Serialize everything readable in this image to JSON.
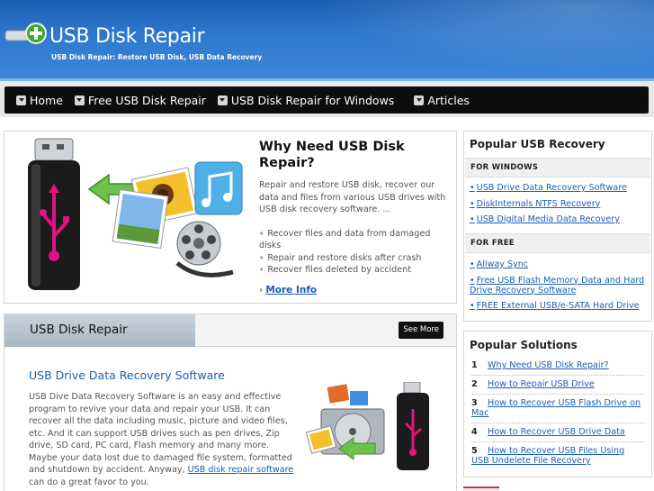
{
  "header": {
    "title": "USB Disk Repair",
    "tagline": "USB Disk Repair: Restore USB Disk, USB Data Recovery"
  },
  "nav": {
    "items": [
      {
        "label": "Home"
      },
      {
        "label": "Free USB Disk Repair"
      },
      {
        "label": "USB Disk Repair for Windows"
      },
      {
        "label": "Articles"
      }
    ]
  },
  "hero": {
    "title": "Why Need USB Disk Repair?",
    "description": "Repair and restore USB disk, recover our data and files from various USB drives with USB disk recovery software. ...",
    "bullets": [
      "Recover files and data from damaged disks",
      "Repair and restore disks after crash",
      "Recover files deleted by accident"
    ],
    "more_label": "More Info"
  },
  "section": {
    "tab_label": "USB Disk Repair",
    "see_more_label": "See More",
    "article_title": "USB Drive Data Recovery Software",
    "article_body": "USB Dive Data Recovery Software is an easy and effective program to revive your data and repair your USB. It can recover all the data including music, picture and video files, etc. And it can support USB drives such as pen drives, Zip drive, SD card, PC card, Flash memory and many more. Maybe your data lost due to damaged file system, formatted and shutdown by accident. Anyway,",
    "article_link": "USB disk repair software",
    "article_tail": "can do a great favor to you."
  },
  "sidebar": {
    "recovery_title": "Popular USB Recovery",
    "windows_heading": "FOR WINDOWS",
    "windows_links": [
      "USB Drive Data Recovery Software",
      "DiskInternals NTFS Recovery",
      "USB Digital Media Data Recovery"
    ],
    "free_heading": "FOR FREE",
    "free_links": [
      "Allway Sync",
      "Free USB Flash Memory Data and Hard Drive Recovery Software",
      "FREE External USB/e-SATA Hard Drive"
    ],
    "solutions_title": "Popular Solutions",
    "solutions": [
      {
        "num": "1",
        "label": "Why Need USB Disk Repair?"
      },
      {
        "num": "2",
        "label": "How to Repair USB Drive"
      },
      {
        "num": "3",
        "label": "How to Recover USB Flash Drive on Mac"
      },
      {
        "num": "4",
        "label": "How to Recover USB Drive Data"
      },
      {
        "num": "5",
        "label": "How to Recover USB Files Using USB Undelete File Recovery"
      }
    ]
  },
  "colors": {
    "header_blue": "#2f79cf",
    "nav_black": "#0d0d0d",
    "link_blue": "#1a5fb4",
    "accent_green": "#5fa418",
    "usb_pink": "#e0147c"
  },
  "icons": [
    "usb-logo-icon",
    "chevron-down-icon",
    "arrow-right-icon"
  ]
}
